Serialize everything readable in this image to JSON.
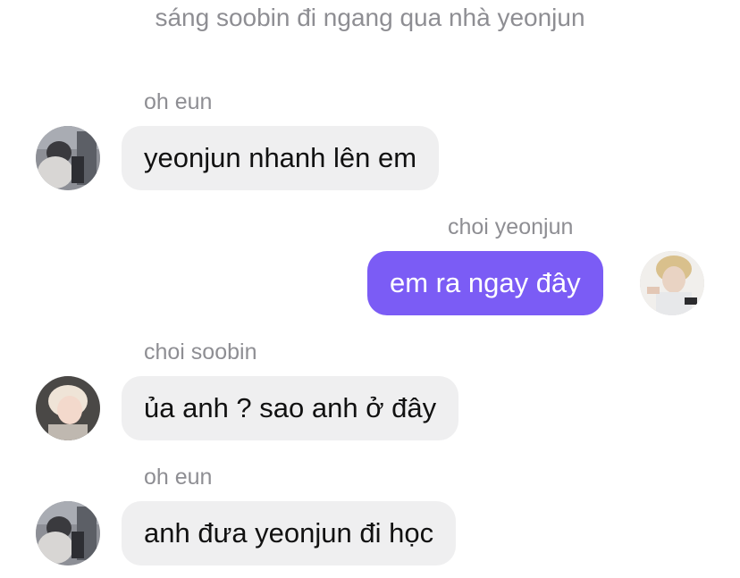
{
  "narration": "sáng soobin đi ngang qua nhà yeonjun",
  "messages": [
    {
      "sender": "oh eun",
      "text": "yeonjun nhanh lên em",
      "side": "incoming",
      "avatar_icon": "oh-eun-avatar"
    },
    {
      "sender": "choi yeonjun",
      "text": "em ra ngay đây",
      "side": "outgoing",
      "avatar_icon": "choi-yeonjun-avatar"
    },
    {
      "sender": "choi soobin",
      "text": "ủa anh ? sao anh ở đây",
      "side": "incoming",
      "avatar_icon": "choi-soobin-avatar"
    },
    {
      "sender": "oh eun",
      "text": "anh đưa yeonjun đi học",
      "side": "incoming",
      "avatar_icon": "oh-eun-avatar"
    }
  ],
  "colors": {
    "outgoing_bubble": "#7b5cf5",
    "incoming_bubble": "#efeff0",
    "sender_text": "#8e8e93"
  }
}
